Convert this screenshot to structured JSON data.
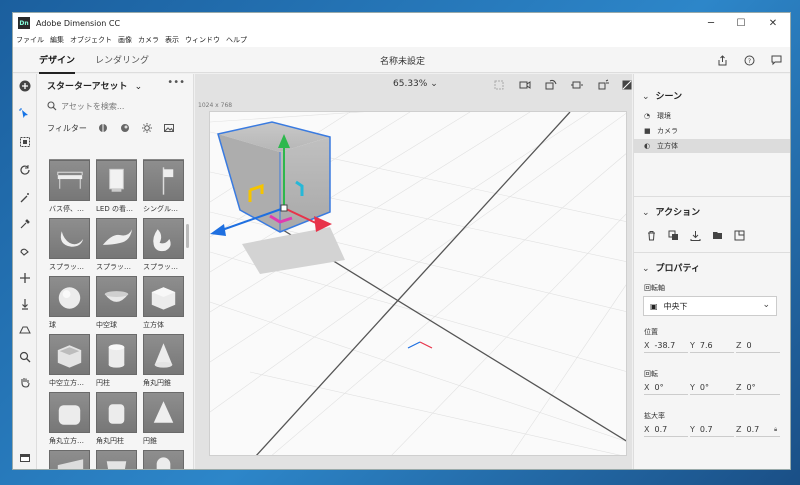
{
  "window": {
    "app_badge": "Dn",
    "title": "Adobe Dimension CC",
    "minimize": "─",
    "maximize": "☐",
    "close": "✕"
  },
  "menu": [
    "ファイル",
    "編集",
    "オブジェクト",
    "画像",
    "カメラ",
    "表示",
    "ウィンドウ",
    "ヘルプ"
  ],
  "tabs": {
    "design": "デザイン",
    "render": "レンダリング"
  },
  "document": {
    "title": "名称未設定"
  },
  "header_icons": [
    "share-icon",
    "help-icon",
    "chat-icon"
  ],
  "toolbar": [
    "add-icon",
    "select-icon",
    "select-all-icon",
    "orbit-icon",
    "magic-wand-icon",
    "eyedropper-icon",
    "paint-icon",
    "move-icon",
    "drop-to-ground-icon",
    "horizon-icon",
    "zoom-icon",
    "hand-icon"
  ],
  "assets": {
    "header": "スターターアセット",
    "more": "•••",
    "search_placeholder": "アセットを検索...",
    "filter_label": "フィルター",
    "items": [
      {
        "label": "バス停、…",
        "shape": "bench"
      },
      {
        "label": "LED の看…",
        "shape": "sign"
      },
      {
        "label": "シングル…",
        "shape": "flag"
      },
      {
        "label": "スプラッ…",
        "shape": "splash"
      },
      {
        "label": "スプラッ…",
        "shape": "splash2"
      },
      {
        "label": "スプラッ…",
        "shape": "splash3"
      },
      {
        "label": "球",
        "shape": "sphere"
      },
      {
        "label": "中空球",
        "shape": "bowl"
      },
      {
        "label": "立方体",
        "shape": "cube"
      },
      {
        "label": "中空立方…",
        "shape": "box"
      },
      {
        "label": "円柱",
        "shape": "cylinder"
      },
      {
        "label": "角丸円錐",
        "shape": "cone"
      },
      {
        "label": "角丸立方…",
        "shape": "roundcube"
      },
      {
        "label": "角丸円柱",
        "shape": "roundcyl"
      },
      {
        "label": "円錐",
        "shape": "cone2"
      },
      {
        "label": "",
        "shape": "wedge"
      },
      {
        "label": "",
        "shape": "prism"
      },
      {
        "label": "",
        "shape": "capsule"
      }
    ]
  },
  "viewport": {
    "zoom": "65.33%",
    "canvas_size": "1024 x 768"
  },
  "scene": {
    "header": "シーン",
    "items": [
      {
        "label": "環境",
        "icon": "environment-icon"
      },
      {
        "label": "カメラ",
        "icon": "camera-icon"
      },
      {
        "label": "立方体",
        "icon": "cube-icon",
        "selected": true
      }
    ]
  },
  "actions": {
    "header": "アクション",
    "icons": [
      "delete-icon",
      "duplicate-icon",
      "drop-icon",
      "group-icon",
      "export-icon"
    ]
  },
  "properties": {
    "header": "プロパティ",
    "pivot_label": "回転軸",
    "pivot_value": "中央下",
    "position_label": "位置",
    "position": {
      "x": "-38.7",
      "y": "7.6",
      "z": "0"
    },
    "rotation_label": "回転",
    "rotation": {
      "x": "0°",
      "y": "0°",
      "z": "0°"
    },
    "scale_label": "拡大率",
    "scale": {
      "x": "0.7",
      "y": "0.7",
      "z": "0.7"
    }
  },
  "colors": {
    "accent": "#1473e6",
    "gizmo_x": "#e8334a",
    "gizmo_y": "#2db84d",
    "gizmo_z": "#1e6fe0",
    "selection": "#3a7be0"
  }
}
